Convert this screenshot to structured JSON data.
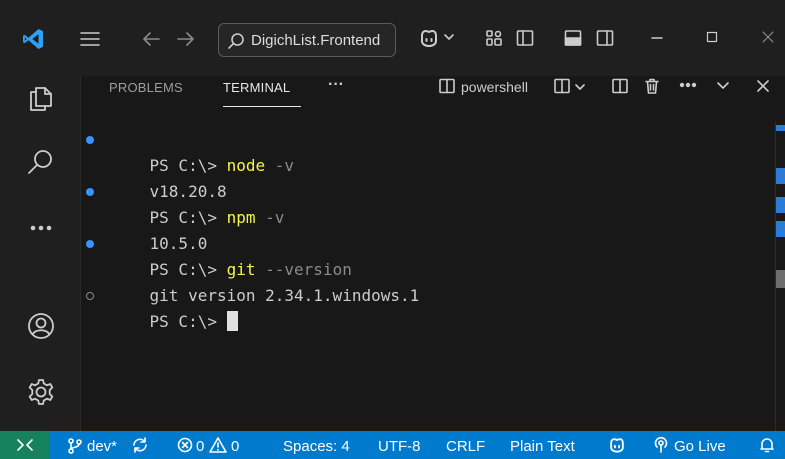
{
  "titlebar": {
    "search_text": "DigichList.Frontend"
  },
  "panel": {
    "tabs": [
      {
        "label": "PROBLEMS",
        "active": false
      },
      {
        "label": "TERMINAL",
        "active": true
      }
    ],
    "more_label": "···",
    "terminal_shell": "powershell"
  },
  "terminal": {
    "lines": [
      {
        "prompt": "PS C:\\> ",
        "command": "node",
        "args": " -v",
        "marker": "blue"
      },
      {
        "output": "v18.20.8"
      },
      {
        "prompt": "PS C:\\> ",
        "command": "npm",
        "args": " -v",
        "marker": "blue"
      },
      {
        "output": "10.5.0"
      },
      {
        "prompt": "PS C:\\> ",
        "command": "git",
        "args": " --version",
        "marker": "blue"
      },
      {
        "output": "git version 2.34.1.windows.1"
      },
      {
        "prompt": "PS C:\\> ",
        "marker": "hollow"
      }
    ]
  },
  "statusbar": {
    "branch": "dev*",
    "errors": "0",
    "warnings": "0",
    "spaces": "Spaces: 4",
    "encoding": "UTF-8",
    "eol": "CRLF",
    "language": "Plain Text",
    "live": "Go Live"
  },
  "colors": {
    "accent": "#007acc",
    "remote": "#16825d",
    "command": "#f5f549",
    "logo": "#2ea0f5"
  }
}
